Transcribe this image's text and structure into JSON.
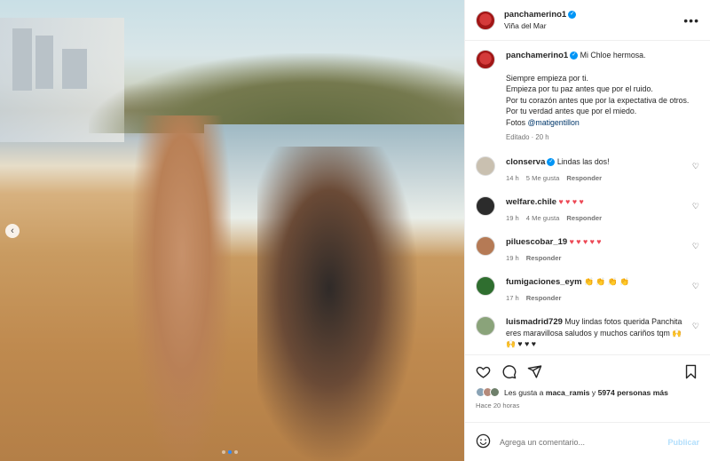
{
  "post": {
    "username": "panchamerino1",
    "location": "Viña del Mar",
    "more_icon": "more-horizontal-icon"
  },
  "caption": {
    "username": "panchamerino1",
    "first_line": "Mi Chloe hermosa.",
    "block": "Siempre empieza por ti.\nEmpieza por tu paz antes que por el ruido.\nPor tu corazón antes que por la expectativa de otros.\nPor tu verdad antes que por el miedo.\nFotos",
    "mention": "@matigentillon",
    "meta": "Editado · 20 h"
  },
  "comments": [
    {
      "username": "clonserva",
      "verified": true,
      "text": "Lindas las dos!",
      "time": "14 h",
      "likes": "5 Me gusta",
      "reply": "Responder",
      "avatar_color": "#c9c0b0"
    },
    {
      "username": "welfare.chile",
      "verified": false,
      "text": "",
      "emoji": "♥ ♥ ♥ ♥",
      "time": "19 h",
      "likes": "4 Me gusta",
      "reply": "Responder",
      "avatar_color": "#2b2b2b"
    },
    {
      "username": "piluescobar_19",
      "verified": false,
      "text": "",
      "emoji": "♥ ♥ ♥ ♥ ♥",
      "time": "19 h",
      "likes": "",
      "reply": "Responder",
      "avatar_color": "#b57a55"
    },
    {
      "username": "fumigaciones_eym",
      "verified": false,
      "text": "",
      "emoji": "👏 👏 👏 👏",
      "time": "17 h",
      "likes": "",
      "reply": "Responder",
      "avatar_color": "#2f6e2f"
    },
    {
      "username": "luismadrid729",
      "verified": false,
      "text": "Muy lindas fotos querida Panchita eres maravillosa saludos y muchos cariños tqm 🙌 🙌 ♥ ♥ ♥",
      "time": "",
      "likes": "",
      "reply": "",
      "avatar_color": "#8aa37a"
    }
  ],
  "likes": {
    "prefix": "Les gusta a",
    "user": "maca_ramis",
    "middle": "y",
    "count": "5974 personas más"
  },
  "time_ago": "Hace 20 horas",
  "add_comment": {
    "placeholder": "Agrega un comentario...",
    "publish": "Publicar"
  }
}
